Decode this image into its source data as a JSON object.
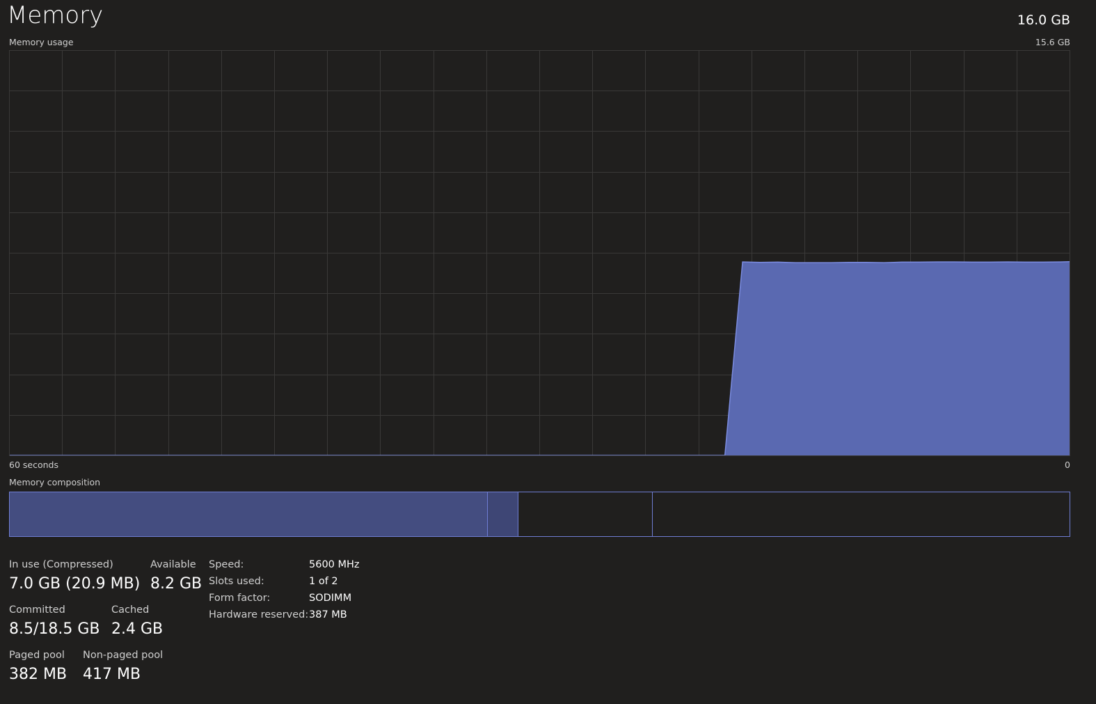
{
  "header": {
    "title": "Memory",
    "total": "16.0 GB"
  },
  "usage_graph": {
    "label": "Memory usage",
    "max_label": "15.6 GB",
    "time_left_label": "60 seconds",
    "time_right_label": "0",
    "fill_color": "#5a69b1",
    "line_color": "#7b8ce0",
    "grid_color": "#3a3938"
  },
  "chart_data": {
    "type": "area",
    "ylim": [
      0,
      15.6
    ],
    "xlim": [
      60,
      0
    ],
    "x": [
      60,
      19.5,
      18.5,
      17.5,
      16.5,
      15.5,
      14.5,
      13.5,
      12.5,
      11.5,
      10.5,
      9.5,
      8.5,
      7.5,
      6.5,
      5.5,
      4.5,
      3.5,
      2.5,
      1.5,
      0.5,
      0
    ],
    "values": [
      0,
      0,
      7.45,
      7.43,
      7.44,
      7.42,
      7.42,
      7.42,
      7.43,
      7.43,
      7.42,
      7.44,
      7.44,
      7.45,
      7.45,
      7.44,
      7.44,
      7.45,
      7.44,
      7.44,
      7.45,
      7.46
    ],
    "grid": true
  },
  "composition": {
    "label": "Memory composition",
    "border_color": "#6f7ed4",
    "fill_in_use": "#444d80",
    "fill_modified": "#3e4675",
    "segments_fraction": [
      0.451,
      0.029,
      0.127,
      0.393
    ]
  },
  "stats": {
    "in_use_label": "In use (Compressed)",
    "in_use_value": "7.0 GB (20.9 MB)",
    "available_label": "Available",
    "available_value": "8.2 GB",
    "committed_label": "Committed",
    "committed_value": "8.5/18.5 GB",
    "cached_label": "Cached",
    "cached_value": "2.4 GB",
    "paged_label": "Paged pool",
    "paged_value": "382 MB",
    "nonpaged_label": "Non-paged pool",
    "nonpaged_value": "417 MB"
  },
  "details": {
    "speed_label": "Speed:",
    "speed_value": "5600 MHz",
    "slots_label": "Slots used:",
    "slots_value": "1 of 2",
    "form_label": "Form factor:",
    "form_value": "SODIMM",
    "reserved_label": "Hardware reserved:",
    "reserved_value": "387 MB"
  }
}
